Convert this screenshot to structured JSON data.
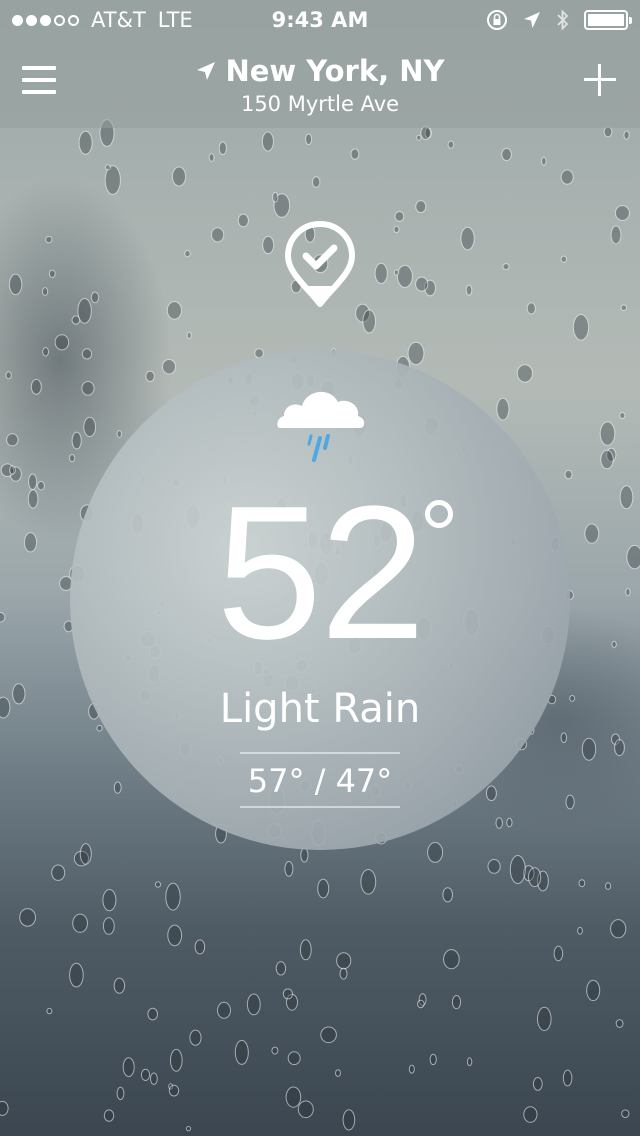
{
  "status_bar": {
    "signal_dots": [
      true,
      true,
      true,
      false,
      false
    ],
    "carrier": "AT&T",
    "network": "LTE",
    "time": "9:43 AM",
    "battery_level": 1.0
  },
  "header": {
    "city": "New York, NY",
    "address": "150 Myrtle Ave"
  },
  "weather": {
    "icon": "rain-cloud-icon",
    "temperature": "52",
    "condition": "Light Rain",
    "high_low": "57° / 47°"
  },
  "colors": {
    "topbar": "#969e9c",
    "accent_rain": "#4fa8e0",
    "text": "#ffffff"
  }
}
